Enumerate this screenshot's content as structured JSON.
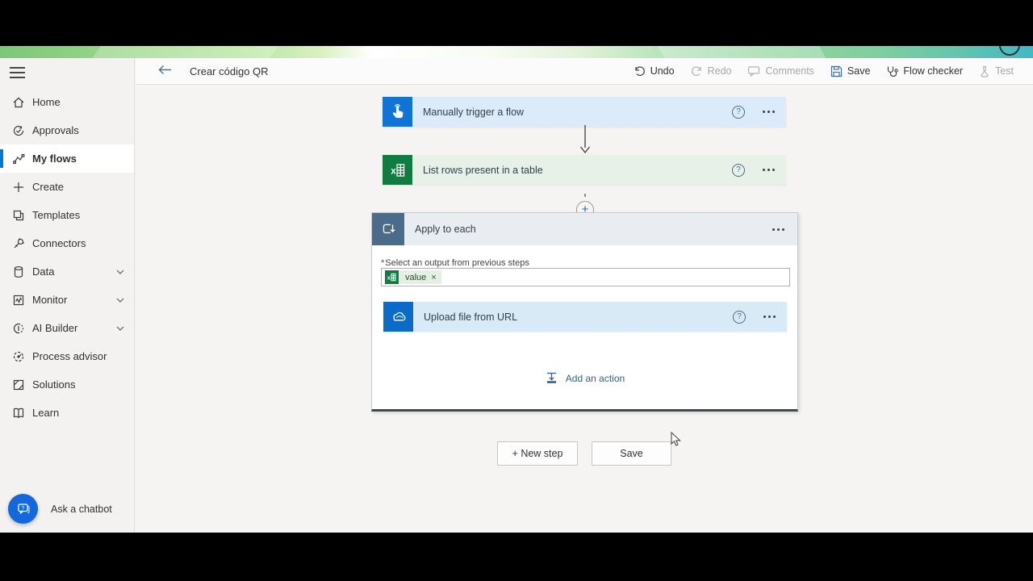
{
  "header": {
    "title": "Crear código QR",
    "toolbar": [
      {
        "label": "Undo",
        "enabled": true
      },
      {
        "label": "Redo",
        "enabled": false
      },
      {
        "label": "Comments",
        "enabled": false
      },
      {
        "label": "Save",
        "enabled": true
      },
      {
        "label": "Flow checker",
        "enabled": true
      },
      {
        "label": "Test",
        "enabled": false
      }
    ]
  },
  "sidebar": {
    "items": [
      {
        "label": "Home",
        "active": false,
        "expandable": false
      },
      {
        "label": "Approvals",
        "active": false,
        "expandable": false
      },
      {
        "label": "My flows",
        "active": true,
        "expandable": false
      },
      {
        "label": "Create",
        "active": false,
        "expandable": false
      },
      {
        "label": "Templates",
        "active": false,
        "expandable": false
      },
      {
        "label": "Connectors",
        "active": false,
        "expandable": false
      },
      {
        "label": "Data",
        "active": false,
        "expandable": true
      },
      {
        "label": "Monitor",
        "active": false,
        "expandable": true
      },
      {
        "label": "AI Builder",
        "active": false,
        "expandable": true
      },
      {
        "label": "Process advisor",
        "active": false,
        "expandable": false
      },
      {
        "label": "Solutions",
        "active": false,
        "expandable": false
      },
      {
        "label": "Learn",
        "active": false,
        "expandable": false
      }
    ],
    "chatbot_label": "Ask a chatbot"
  },
  "flow": {
    "trigger": {
      "label": "Manually trigger a flow"
    },
    "list_rows": {
      "label": "List rows present in a table"
    },
    "apply_to_each": {
      "label": "Apply to each",
      "required_mark": "*",
      "field_label": "Select an output from previous steps",
      "chip_value": "value"
    },
    "upload": {
      "label": "Upload file from URL"
    },
    "add_action_label": "Add an action"
  },
  "footer_buttons": {
    "new_step": "+ New step",
    "save": "Save"
  },
  "colors": {
    "accent_blue": "#0078d4",
    "trigger_icon_blue": "#1173d4",
    "excel_green": "#107c41",
    "loop_slate_blue": "#4a6b8a",
    "onedrive_blue": "#0d6bc8",
    "banner_green": "#9ed98b",
    "chatbot_blue": "#1368dc"
  }
}
